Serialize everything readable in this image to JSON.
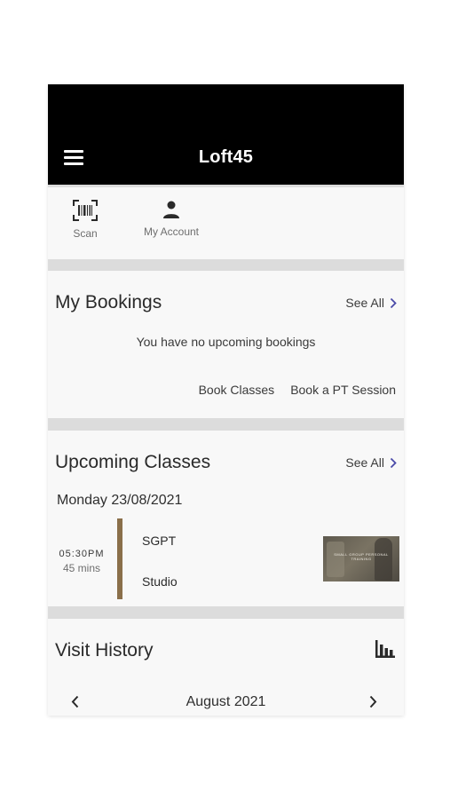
{
  "header": {
    "title": "Loft45"
  },
  "quick_actions": [
    {
      "label": "Scan",
      "icon": "barcode-scan-icon"
    },
    {
      "label": "My Account",
      "icon": "person-icon"
    }
  ],
  "bookings": {
    "title": "My Bookings",
    "see_all": "See All",
    "empty_message": "You have no upcoming bookings",
    "links": [
      "Book Classes",
      "Book a PT Session"
    ]
  },
  "classes": {
    "title": "Upcoming Classes",
    "see_all": "See All",
    "date": "Monday 23/08/2021",
    "items": [
      {
        "time": "05:30PM",
        "duration": "45 mins",
        "name": "SGPT",
        "location": "Studio",
        "thumb_caption": "SMALL GROUP PERSONAL TRAINING",
        "bar_color": "#8a6f4a"
      }
    ]
  },
  "visits": {
    "title": "Visit History",
    "month": "August 2021"
  },
  "colors": {
    "header_bg": "#000000",
    "accent": "#4a4aa8",
    "divider": "#dcdcdc",
    "card_bg": "#f8f8f8"
  }
}
